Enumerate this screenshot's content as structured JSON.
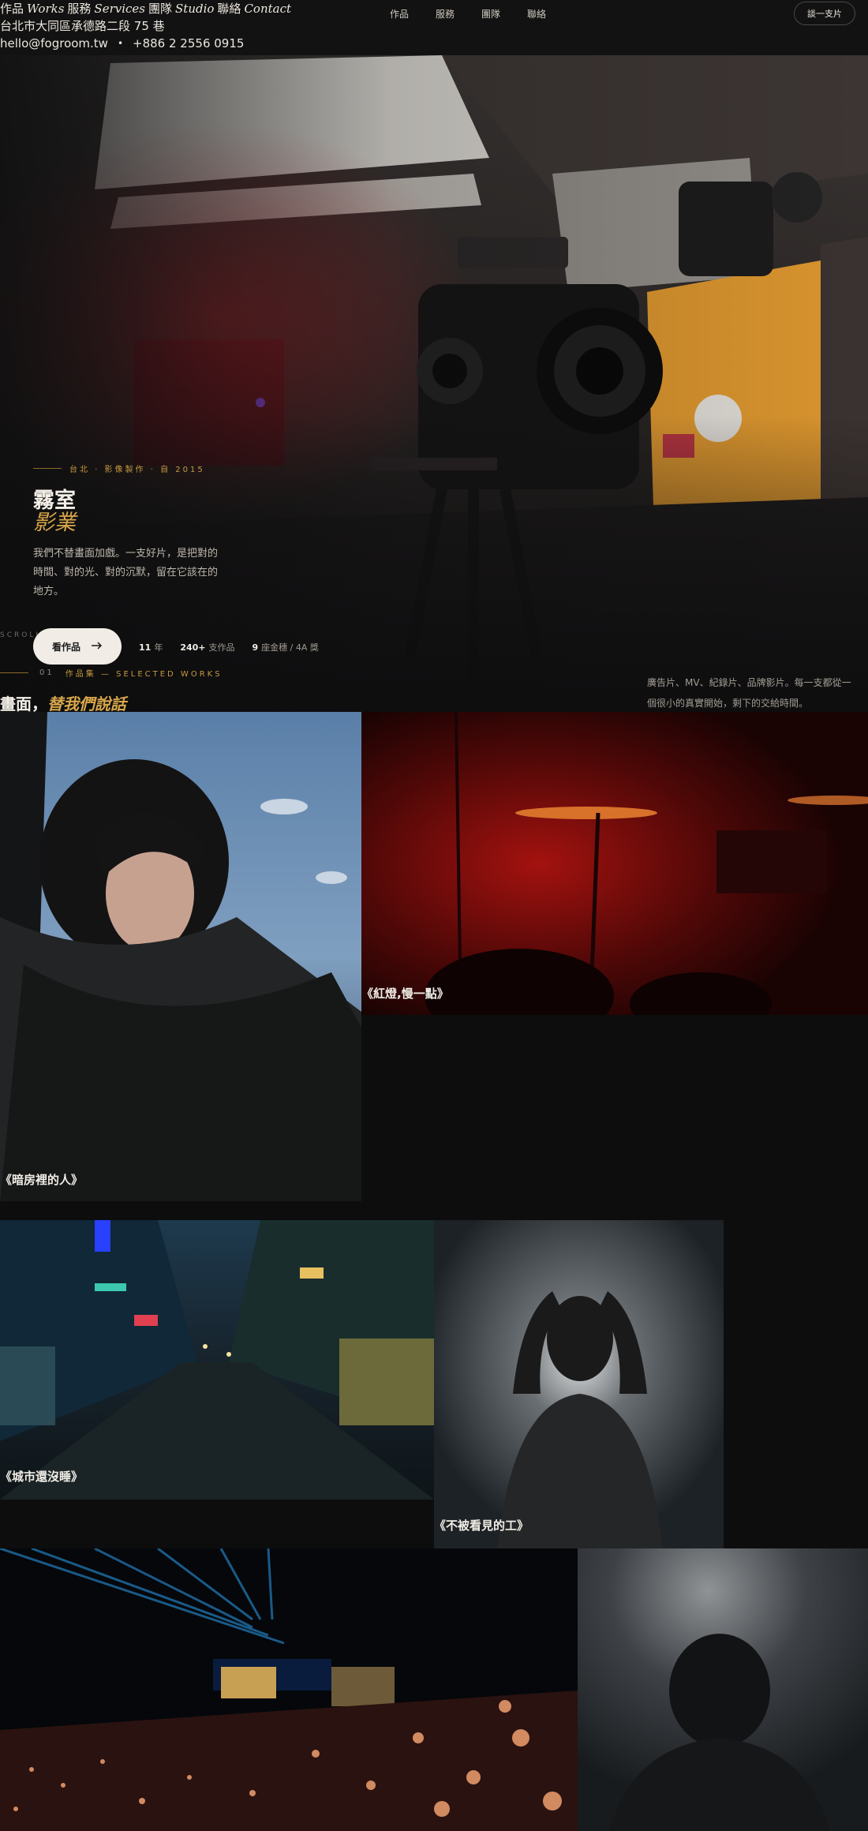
{
  "header": {
    "brand_row": [
      "作品",
      "Works",
      "服務",
      "Services",
      "團隊",
      "Studio",
      "聯絡",
      "Contact"
    ],
    "brand_name": "霧室影業",
    "address": "台北市大同區承德路二段 75 巷",
    "email": "hello@fogroom.tw",
    "separator": "•",
    "phone": "+886 2 2556 0915",
    "nav": [
      "作品",
      "服務",
      "團隊",
      "聯絡"
    ],
    "cta_label": "談一支片"
  },
  "hero": {
    "kicker": "台北 · 影像製作 · 自 2015",
    "title_line1": "霧室",
    "title_line2": "影業",
    "description": "我們不替畫面加戲。一支好片，是把對的時間、對的光、對的沉默，留在它該在的地方。",
    "scroll_label": "SCROLL",
    "watch_button": "看作品",
    "stats": [
      {
        "value": "11",
        "label": "年"
      },
      {
        "value": "240+",
        "label": "支作品"
      },
      {
        "value": "9",
        "label": "座金穗 / 4A 獎"
      }
    ]
  },
  "works": {
    "number": "01",
    "kicker": "作品集 — SELECTED WORKS",
    "title_plain": "畫面，",
    "title_accent": "替我們說話",
    "description": "廣告片、MV、紀錄片、品牌影片。每一支都從一個很小的真實開始，剩下的交給時間。",
    "items": [
      {
        "title": "《暗房裡的人》"
      },
      {
        "title": "《紅燈,慢一點》"
      },
      {
        "title": "《城市還沒睡》"
      },
      {
        "title": "《不被看見的工》"
      }
    ]
  },
  "colors": {
    "background": "#0d0d0e",
    "accent_gold": "#d8a74a",
    "text": "#e8e4dc"
  }
}
